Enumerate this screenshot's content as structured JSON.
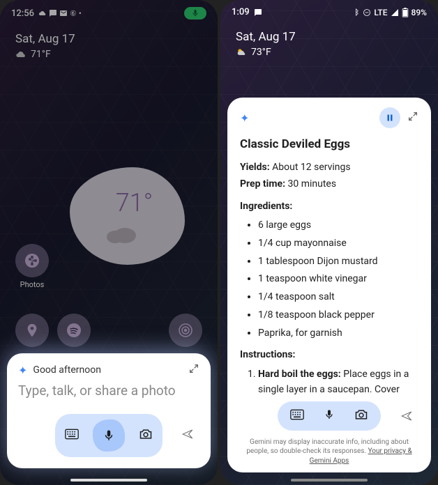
{
  "left": {
    "status": {
      "time": "12:56",
      "icons": [
        "cloud",
        "message",
        "mail",
        "threads",
        "more"
      ]
    },
    "date": "Sat, Aug 17",
    "weather_small": {
      "icon": "cloud",
      "temp": "71°F"
    },
    "weather_widget": {
      "temp": "71°"
    },
    "photos_label": "Photos",
    "gemini": {
      "greeting": "Good afternoon",
      "placeholder": "Type, talk, or share a photo"
    }
  },
  "right": {
    "status": {
      "time": "1:09",
      "network": "LTE",
      "battery": "89%"
    },
    "date": "Sat, Aug 17",
    "weather_small": {
      "icon": "partly-sunny",
      "temp": "73°F"
    },
    "recipe": {
      "title": "Classic Deviled Eggs",
      "yields_label": "Yields:",
      "yields_value": "About 12 servings",
      "prep_label": "Prep time:",
      "prep_value": "30 minutes",
      "ingredients_label": "Ingredients:",
      "ingredients": [
        "6 large eggs",
        "1/4 cup mayonnaise",
        "1 tablespoon Dijon mustard",
        "1 teaspoon white vinegar",
        "1/4 teaspoon salt",
        "1/8 teaspoon black pepper",
        "Paprika, for garnish"
      ],
      "instructions_label": "Instructions:",
      "step1_title": "Hard boil the eggs:",
      "step1_text": "Place eggs in a single layer in a saucepan. Cover with cold water by about an inch. Bring to a boil, then remove from heat and cover. Let sit for 10 minutes. Run cold water over"
    },
    "disclaimer": "Gemini may display inaccurate info, including about people, so double-check its responses.",
    "disclaimer_link": "Your privacy & Gemini Apps"
  }
}
